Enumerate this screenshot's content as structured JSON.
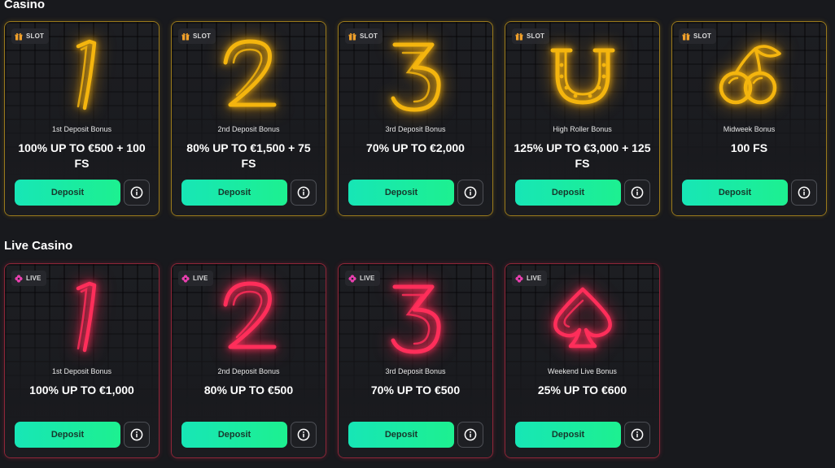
{
  "sections": {
    "casino": {
      "title": "Casino",
      "cards": [
        {
          "badge": "SLOT",
          "art": "neon-number-1",
          "name": "1st Deposit Bonus",
          "offer": "100% UP TO €500 + 100 FS",
          "button": "Deposit"
        },
        {
          "badge": "SLOT",
          "art": "neon-number-2",
          "name": "2nd Deposit Bonus",
          "offer": "80% UP TO €1,500 + 75 FS",
          "button": "Deposit"
        },
        {
          "badge": "SLOT",
          "art": "neon-number-3",
          "name": "3rd Deposit Bonus",
          "offer": "70% UP TO €2,000",
          "button": "Deposit"
        },
        {
          "badge": "SLOT",
          "art": "neon-horseshoe",
          "name": "High Roller Bonus",
          "offer": "125% UP TO €3,000 + 125 FS",
          "button": "Deposit"
        },
        {
          "badge": "SLOT",
          "art": "neon-cherries",
          "name": "Midweek Bonus",
          "offer": "100 FS",
          "button": "Deposit"
        }
      ]
    },
    "live": {
      "title": "Live Casino",
      "cards": [
        {
          "badge": "LIVE",
          "art": "neon-number-1",
          "name": "1st Deposit Bonus",
          "offer": "100% UP TO €1,000",
          "button": "Deposit"
        },
        {
          "badge": "LIVE",
          "art": "neon-number-2",
          "name": "2nd Deposit Bonus",
          "offer": "80% UP TO €500",
          "button": "Deposit"
        },
        {
          "badge": "LIVE",
          "art": "neon-number-3",
          "name": "3rd Deposit Bonus",
          "offer": "70% UP TO €500",
          "button": "Deposit"
        },
        {
          "badge": "LIVE",
          "art": "neon-spade",
          "name": "Weekend Live Bonus",
          "offer": "25% UP TO €600",
          "button": "Deposit"
        }
      ]
    }
  },
  "colors": {
    "background": "#18191d",
    "casino_neon": "#f4b50e",
    "live_neon": "#ff2e5a",
    "deposit_button": "#17e6b6",
    "slot_badge_icon": "#f0a02a",
    "live_badge_icon": "#e83fae"
  },
  "icons": {
    "slot_badge": "gift-icon",
    "live_badge": "flower-icon",
    "info_button": "info-icon"
  }
}
